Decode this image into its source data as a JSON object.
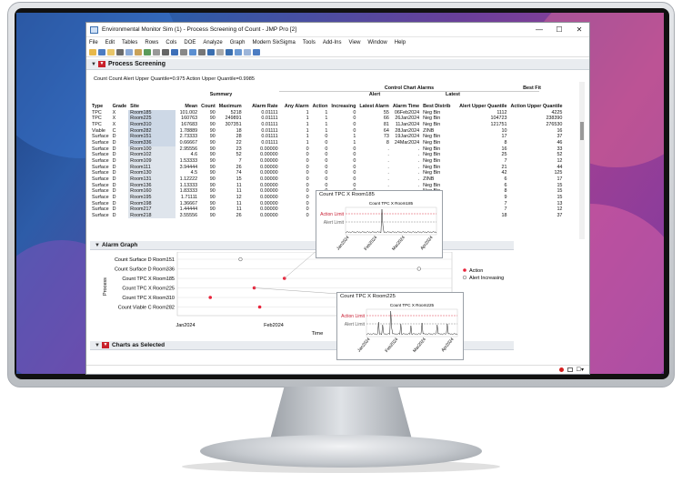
{
  "window": {
    "title": "Environmental Monitor Sim (1) - Process Screening of Count - JMP Pro [2]"
  },
  "menu": [
    "File",
    "Edit",
    "Tables",
    "Rows",
    "Cols",
    "DOE",
    "Analyze",
    "Graph",
    "Modern SixSigma",
    "Tools",
    "Add-Ins",
    "View",
    "Window",
    "Help"
  ],
  "process_screening": {
    "title": "Process Screening",
    "info": "Count   Count  Alert Upper Quantile=0.975  Action Upper Quantile=0.9985",
    "group_headers": {
      "control_chart_alarms": "Control Chart Alarms",
      "best_fit": "Best Fit",
      "summary": "Summary",
      "alert": "Alert",
      "latest": "Latest"
    },
    "columns": [
      "Type",
      "Grade",
      "Site",
      "Mean",
      "Count",
      "Maximum",
      "Alarm Rate",
      "Any Alarm",
      "Action",
      "Increasing",
      "Latest Alarm",
      "Alarm Time",
      "Best Distrib",
      "Alert Upper Quantile",
      "Action Upper Quantile"
    ],
    "rows": [
      [
        "TPC",
        "X",
        "Room185",
        "101.002",
        "90",
        "5218",
        "0.01111",
        "1",
        "1",
        "0",
        "55",
        "06Feb2024",
        "Neg Bin",
        "1112",
        "4225"
      ],
      [
        "TPC",
        "X",
        "Room225",
        "160763",
        "90",
        "249891",
        "0.01111",
        "1",
        "1",
        "0",
        "66",
        "26Jan2024",
        "Neg Bin",
        "104723",
        "238390"
      ],
      [
        "TPC",
        "X",
        "Room310",
        "167683",
        "90",
        "307351",
        "0.01111",
        "1",
        "1",
        "0",
        "81",
        "11Jan2024",
        "Neg Bin",
        "121751",
        "276530"
      ],
      [
        "Viable",
        "C",
        "Room282",
        "1.78889",
        "90",
        "18",
        "0.01111",
        "1",
        "1",
        "0",
        "64",
        "28Jan2024",
        "ZINB",
        "10",
        "16"
      ],
      [
        "Surface",
        "D",
        "Room151",
        "2.73333",
        "90",
        "28",
        "0.01111",
        "1",
        "0",
        "1",
        "73",
        "19Jan2024",
        "Neg Bin",
        "17",
        "37"
      ],
      [
        "Surface",
        "D",
        "Room336",
        "0.66667",
        "90",
        "22",
        "0.01111",
        "1",
        "0",
        "1",
        "8",
        "24Mar2024",
        "Neg Bin",
        "8",
        "46"
      ],
      [
        "Surface",
        "D",
        "Room100",
        "2.95556",
        "90",
        "23",
        "0.00000",
        "0",
        "0",
        "0",
        ".",
        ".",
        "Neg Bin",
        "16",
        "33"
      ],
      [
        "Surface",
        "D",
        "Room102",
        "4.6",
        "90",
        "52",
        "0.00000",
        "0",
        "0",
        "0",
        ".",
        ".",
        "Neg Bin",
        "25",
        "52"
      ],
      [
        "Surface",
        "D",
        "Room109",
        "1.53333",
        "90",
        "7",
        "0.00000",
        "0",
        "0",
        "0",
        ".",
        ".",
        "Neg Bin",
        "7",
        "12"
      ],
      [
        "Surface",
        "D",
        "Room111",
        "3.94444",
        "90",
        "26",
        "0.00000",
        "0",
        "0",
        "0",
        ".",
        ".",
        "Neg Bin",
        "21",
        "44"
      ],
      [
        "Surface",
        "D",
        "Room130",
        "4.5",
        "90",
        "74",
        "0.00000",
        "0",
        "0",
        "0",
        ".",
        ".",
        "Neg Bin",
        "42",
        "125"
      ],
      [
        "Surface",
        "D",
        "Room131",
        "1.12222",
        "90",
        "15",
        "0.00000",
        "0",
        "0",
        "0",
        ".",
        ".",
        "ZINB",
        "6",
        "17"
      ],
      [
        "Surface",
        "D",
        "Room136",
        "1.13333",
        "90",
        "11",
        "0.00000",
        "0",
        "0",
        "0",
        ".",
        ".",
        "Neg Bin",
        "6",
        "15"
      ],
      [
        "Surface",
        "D",
        "Room160",
        "1.83333",
        "90",
        "11",
        "0.00000",
        "0",
        "0",
        "0",
        ".",
        ".",
        "Neg Bin",
        "8",
        "15"
      ],
      [
        "Surface",
        "D",
        "Room195",
        "1.71111",
        "90",
        "12",
        "0.00000",
        "0",
        "0",
        "0",
        ".",
        ".",
        "ZINB",
        "9",
        "15"
      ],
      [
        "Surface",
        "D",
        "Room198",
        "1.36667",
        "90",
        "11",
        "0.00000",
        "0",
        "0",
        "0",
        ".",
        ".",
        "Neg Bin",
        "7",
        "13"
      ],
      [
        "Surface",
        "D",
        "Room217",
        "1.44444",
        "90",
        "11",
        "0.00000",
        "0",
        "0",
        "0",
        ".",
        ".",
        "Neg Bin",
        "7",
        "12"
      ],
      [
        "Surface",
        "D",
        "Room218",
        "3.55556",
        "90",
        "26",
        "0.00000",
        "0",
        "0",
        "0",
        ".",
        ".",
        "Neg Bin",
        "18",
        "37"
      ]
    ]
  },
  "alarm_graph": {
    "title": "Alarm Graph",
    "y_label": "Process",
    "x_label": "Time",
    "x_ticks": [
      "Jan2024",
      "Feb2024"
    ],
    "processes": [
      "Count Surface D Room151",
      "Count Surface D Room336",
      "Count TPC X Room185",
      "Count TPC X Room225",
      "Count TPC X Room310",
      "Count Viable C Room282"
    ],
    "legend": [
      "Action",
      "Alert Increasing"
    ],
    "colors": {
      "action": "#e8233a",
      "alert": "#777777"
    }
  },
  "popup1": {
    "title": "Count TPC X Room185",
    "chart_title": "Count TPC X Room185",
    "action_limit": "Action Limit",
    "alert_limit": "Alert Limit",
    "ticks": [
      "Jan2024",
      "Feb2024",
      "Mar2024",
      "Apr2024"
    ]
  },
  "popup2": {
    "title": "Count TPC X Room225",
    "chart_title": "Count TPC X Room225",
    "action_limit": "Action Limit",
    "alert_limit": "Alert Limit",
    "ticks": [
      "Jan2024",
      "Feb2024",
      "Mar2024",
      "Apr2024"
    ]
  },
  "charts_selected": {
    "title": "Charts as Selected"
  },
  "status": {
    "indicator_color": "#d42020"
  }
}
